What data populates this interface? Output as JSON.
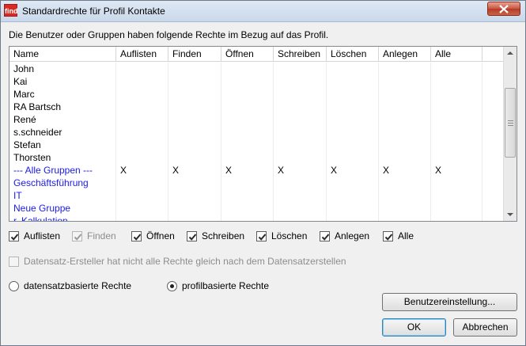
{
  "window": {
    "app_icon_text": "find",
    "title": "Standardrechte für Profil Kontakte"
  },
  "info_text": "Die Benutzer oder Gruppen haben folgende Rechte im Bezug auf das Profil.",
  "grid": {
    "columns": [
      "Name",
      "Auflisten",
      "Finden",
      "Öffnen",
      "Schreiben",
      "Löschen",
      "Anlegen",
      "Alle"
    ],
    "rows": [
      {
        "name": "John",
        "group": false,
        "values": [
          "",
          "",
          "",
          "",
          "",
          "",
          ""
        ]
      },
      {
        "name": "Kai",
        "group": false,
        "values": [
          "",
          "",
          "",
          "",
          "",
          "",
          ""
        ]
      },
      {
        "name": "Marc",
        "group": false,
        "values": [
          "",
          "",
          "",
          "",
          "",
          "",
          ""
        ]
      },
      {
        "name": "RA Bartsch",
        "group": false,
        "values": [
          "",
          "",
          "",
          "",
          "",
          "",
          ""
        ]
      },
      {
        "name": "René",
        "group": false,
        "values": [
          "",
          "",
          "",
          "",
          "",
          "",
          ""
        ]
      },
      {
        "name": "s.schneider",
        "group": false,
        "values": [
          "",
          "",
          "",
          "",
          "",
          "",
          ""
        ]
      },
      {
        "name": "Stefan",
        "group": false,
        "values": [
          "",
          "",
          "",
          "",
          "",
          "",
          ""
        ]
      },
      {
        "name": "Thorsten",
        "group": false,
        "values": [
          "",
          "",
          "",
          "",
          "",
          "",
          ""
        ]
      },
      {
        "name": "--- Alle Gruppen ---",
        "group": true,
        "values": [
          "X",
          "X",
          "X",
          "X",
          "X",
          "X",
          "X"
        ]
      },
      {
        "name": "Geschäftsführung",
        "group": true,
        "values": [
          "",
          "",
          "",
          "",
          "",
          "",
          ""
        ]
      },
      {
        "name": "IT",
        "group": true,
        "values": [
          "",
          "",
          "",
          "",
          "",
          "",
          ""
        ]
      },
      {
        "name": "Neue Gruppe",
        "group": true,
        "values": [
          "",
          "",
          "",
          "",
          "",
          "",
          ""
        ]
      },
      {
        "name": "r. Kalkulation",
        "group": true,
        "values": [
          "",
          "",
          "",
          "",
          "",
          "",
          ""
        ]
      }
    ]
  },
  "rights": [
    {
      "label": "Auflisten",
      "checked": true,
      "disabled": false
    },
    {
      "label": "Finden",
      "checked": true,
      "disabled": true
    },
    {
      "label": "Öffnen",
      "checked": true,
      "disabled": false
    },
    {
      "label": "Schreiben",
      "checked": true,
      "disabled": false
    },
    {
      "label": "Löschen",
      "checked": true,
      "disabled": false
    },
    {
      "label": "Anlegen",
      "checked": true,
      "disabled": false
    },
    {
      "label": "Alle",
      "checked": true,
      "disabled": false
    }
  ],
  "creator_option": {
    "label": "Datensatz-Ersteller hat nicht alle Rechte gleich nach dem  Datensatzerstellen",
    "checked": false,
    "disabled": true
  },
  "mode": {
    "record_label": "datensatzbasierte Rechte",
    "profile_label": "profilbasierte Rechte",
    "selected": "profile"
  },
  "buttons": {
    "user_settings": "Benutzereinstellung...",
    "ok": "OK",
    "cancel": "Abbrechen"
  },
  "colors": {
    "group_text": "#1a1ae6",
    "app_icon": "#d62a24"
  }
}
